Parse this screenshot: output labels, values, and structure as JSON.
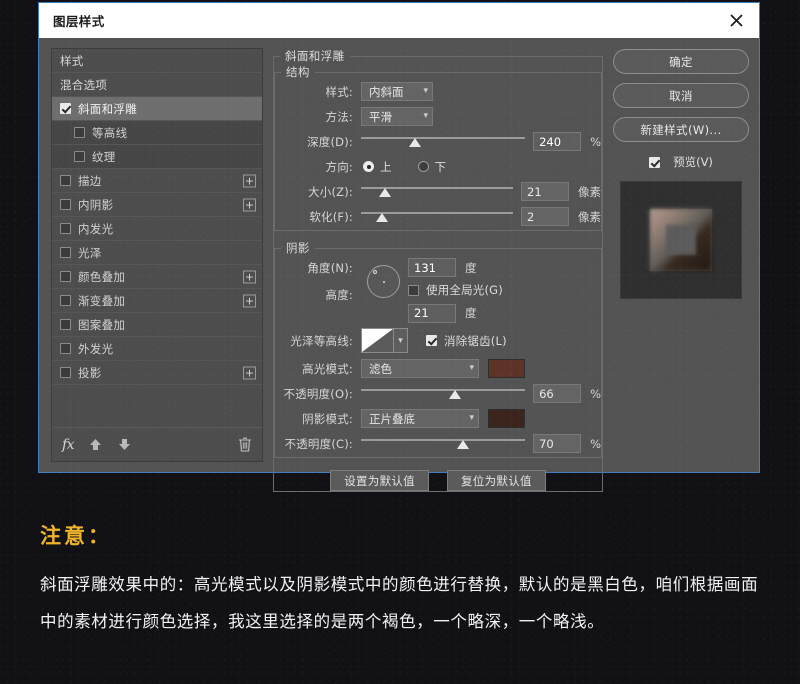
{
  "dialog": {
    "title": "图层样式",
    "close_icon": "close-icon"
  },
  "styles_panel": {
    "items": [
      {
        "label": "样式",
        "type": "header",
        "checkbox": false,
        "checked": false,
        "plus": false,
        "selected": false
      },
      {
        "label": "混合选项",
        "type": "header",
        "checkbox": false,
        "checked": false,
        "plus": false,
        "selected": false
      },
      {
        "label": "斜面和浮雕",
        "type": "normal",
        "checkbox": true,
        "checked": true,
        "plus": false,
        "selected": true
      },
      {
        "label": "等高线",
        "type": "sub",
        "checkbox": true,
        "checked": false,
        "plus": false,
        "selected": false
      },
      {
        "label": "纹理",
        "type": "sub",
        "checkbox": true,
        "checked": false,
        "plus": false,
        "selected": false
      },
      {
        "label": "描边",
        "type": "normal",
        "checkbox": true,
        "checked": false,
        "plus": true,
        "selected": false
      },
      {
        "label": "内阴影",
        "type": "normal",
        "checkbox": true,
        "checked": false,
        "plus": true,
        "selected": false
      },
      {
        "label": "内发光",
        "type": "normal",
        "checkbox": true,
        "checked": false,
        "plus": false,
        "selected": false
      },
      {
        "label": "光泽",
        "type": "normal",
        "checkbox": true,
        "checked": false,
        "plus": false,
        "selected": false
      },
      {
        "label": "颜色叠加",
        "type": "normal",
        "checkbox": true,
        "checked": false,
        "plus": true,
        "selected": false
      },
      {
        "label": "渐变叠加",
        "type": "normal",
        "checkbox": true,
        "checked": false,
        "plus": true,
        "selected": false
      },
      {
        "label": "图案叠加",
        "type": "normal",
        "checkbox": true,
        "checked": false,
        "plus": false,
        "selected": false
      },
      {
        "label": "外发光",
        "type": "normal",
        "checkbox": true,
        "checked": false,
        "plus": false,
        "selected": false
      },
      {
        "label": "投影",
        "type": "normal",
        "checkbox": true,
        "checked": false,
        "plus": true,
        "selected": false
      }
    ],
    "footer": {
      "fx_label": "fx",
      "move_up_icon": "arrow-up-icon",
      "move_down_icon": "arrow-down-icon",
      "delete_icon": "trash-icon"
    }
  },
  "options": {
    "group_title": "斜面和浮雕",
    "structure": {
      "title": "结构",
      "style_label": "样式:",
      "style_value": "内斜面",
      "technique_label": "方法:",
      "technique_value": "平滑",
      "depth_label": "深度(D):",
      "depth_value": "240",
      "depth_unit": "%",
      "depth_pct": 33,
      "direction_label": "方向:",
      "direction_up": "上",
      "direction_down": "下",
      "direction_selected": "up",
      "size_label": "大小(Z):",
      "size_value": "21",
      "size_unit": "像素",
      "size_pct": 16,
      "soften_label": "软化(F):",
      "soften_value": "2",
      "soften_unit": "像素",
      "soften_pct": 14
    },
    "shading": {
      "title": "阴影",
      "angle_label": "角度(N):",
      "angle_value": "131",
      "angle_unit": "度",
      "angle_degrees": 131,
      "global_light_label": "使用全局光(G)",
      "global_light_checked": false,
      "altitude_label": "高度:",
      "altitude_value": "21",
      "altitude_unit": "度",
      "gloss_contour_label": "光泽等高线:",
      "antialias_label": "消除锯齿(L)",
      "antialias_checked": true,
      "highlight_mode_label": "高光模式:",
      "highlight_mode_value": "滤色",
      "highlight_color": "#5c3326",
      "highlight_opacity_label": "不透明度(O):",
      "highlight_opacity_value": "66",
      "highlight_opacity_unit": "%",
      "highlight_opacity_pct": 57,
      "shadow_mode_label": "阴影模式:",
      "shadow_mode_value": "正片叠底",
      "shadow_color": "#3a241c",
      "shadow_opacity_label": "不透明度(C):",
      "shadow_opacity_value": "70",
      "shadow_opacity_unit": "%",
      "shadow_opacity_pct": 62
    },
    "set_default_label": "设置为默认值",
    "reset_default_label": "复位为默认值"
  },
  "right_panel": {
    "ok_label": "确定",
    "cancel_label": "取消",
    "new_style_label": "新建样式(W)...",
    "preview_label": "预览(V)",
    "preview_checked": true
  },
  "caption": {
    "title": "注意：",
    "body": "斜面浮雕效果中的：高光模式以及阴影模式中的颜色进行替换，默认的是黑白色，咱们根据画面中的素材进行颜色选择，我这里选择的是两个褐色，一个略深，一个略浅。"
  },
  "colors": {
    "accent_yellow": "#f0b429",
    "dialog_border_blue": "#3f7fbf",
    "panel_bg": "#535353",
    "backdrop": "#111014"
  }
}
